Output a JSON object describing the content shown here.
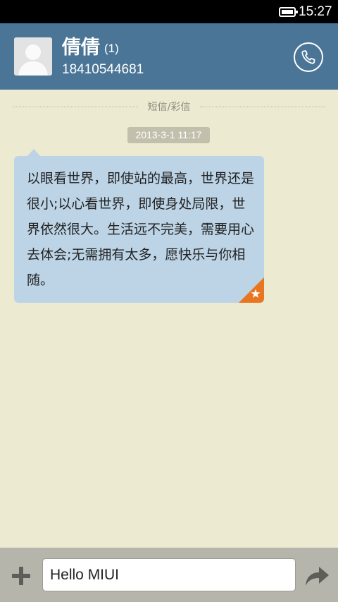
{
  "status_bar": {
    "time": "15:27",
    "battery_level": 1.0,
    "battery_icon": "battery-icon"
  },
  "header": {
    "contact_name": "倩倩",
    "unread_count": "(1)",
    "phone_number": "18410544681",
    "avatar_icon": "person-avatar-icon",
    "call_icon": "phone-icon"
  },
  "thread": {
    "section_label": "短信/彩信",
    "timestamp": "2013-3-1 11:17",
    "messages": [
      {
        "text": "以眼看世界，即使站的最高，世界还是很小;以心看世界，即使身处局限，世界依然很大。生活远不完美，需要用心去体会;无需拥有太多，愿快乐与你相随。",
        "starred": true
      }
    ]
  },
  "composer": {
    "input_value": "Hello MIUI",
    "attach_icon": "plus-icon",
    "send_icon": "send-arrow-icon"
  },
  "colors": {
    "header_bg": "#4b7596",
    "thread_bg": "#ecebd2",
    "bubble_bg": "#bcd4e6",
    "star_corner": "#e8751f"
  }
}
